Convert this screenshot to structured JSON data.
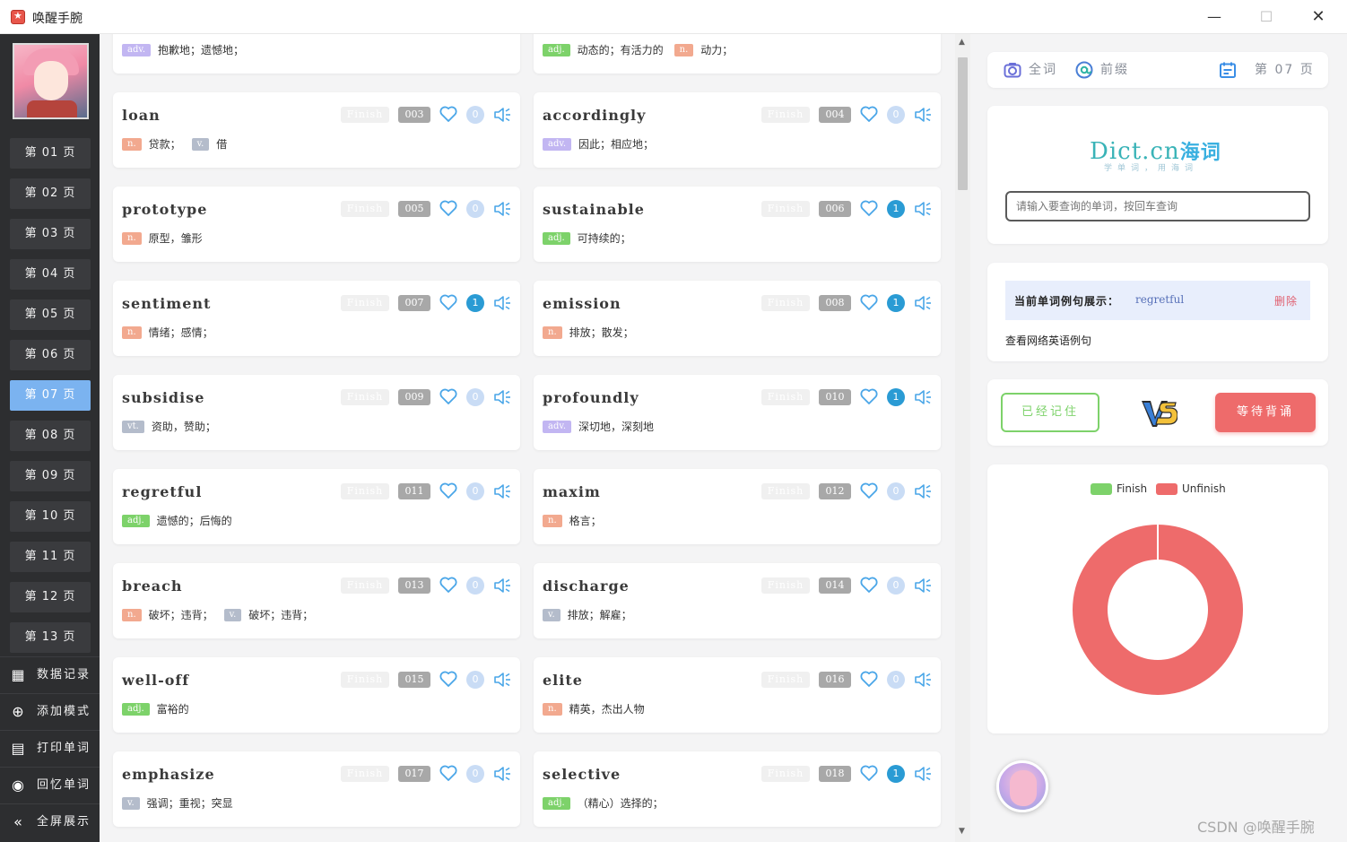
{
  "window": {
    "title": "唤醒手腕"
  },
  "sidebar": {
    "pages": [
      "第 01 页",
      "第 02 页",
      "第 03 页",
      "第 04 页",
      "第 05 页",
      "第 06 页",
      "第 07 页",
      "第 08 页",
      "第 09 页",
      "第 10 页",
      "第 11 页",
      "第 12 页",
      "第 13 页"
    ],
    "active_page_index": 6,
    "menu": [
      {
        "label": "数据记录",
        "icon": "grid-icon"
      },
      {
        "label": "添加模式",
        "icon": "plus-circle-icon"
      },
      {
        "label": "打印单词",
        "icon": "print-icon"
      },
      {
        "label": "回忆单词",
        "icon": "eye-icon"
      },
      {
        "label": "全屏展示",
        "icon": "double-chevron-left-icon"
      }
    ]
  },
  "cards_top": [
    {
      "defs": [
        {
          "pos": "adv.",
          "text": "抱歉地；遗憾地；"
        }
      ]
    },
    {
      "defs": [
        {
          "pos": "adj.",
          "text": "动态的；有活力的"
        },
        {
          "pos": "n.",
          "text": "动力；"
        }
      ]
    }
  ],
  "words": [
    {
      "word": "loan",
      "finish": "Finish",
      "num": "003",
      "count": "0",
      "defs": [
        {
          "pos": "n.",
          "text": "贷款；"
        },
        {
          "pos": "v.",
          "text": "借"
        }
      ]
    },
    {
      "word": "accordingly",
      "finish": "Finish",
      "num": "004",
      "count": "0",
      "defs": [
        {
          "pos": "adv.",
          "text": "因此；相应地；"
        }
      ]
    },
    {
      "word": "prototype",
      "finish": "Finish",
      "num": "005",
      "count": "0",
      "defs": [
        {
          "pos": "n.",
          "text": "原型，雏形"
        }
      ]
    },
    {
      "word": "sustainable",
      "finish": "Finish",
      "num": "006",
      "count": "1",
      "defs": [
        {
          "pos": "adj.",
          "text": "可持续的；"
        }
      ]
    },
    {
      "word": "sentiment",
      "finish": "Finish",
      "num": "007",
      "count": "1",
      "defs": [
        {
          "pos": "n.",
          "text": "情绪；感情；"
        }
      ]
    },
    {
      "word": "emission",
      "finish": "Finish",
      "num": "008",
      "count": "1",
      "defs": [
        {
          "pos": "n.",
          "text": "排放；散发；"
        }
      ]
    },
    {
      "word": "subsidise",
      "finish": "Finish",
      "num": "009",
      "count": "0",
      "defs": [
        {
          "pos": "vt.",
          "text": "资助，赞助；"
        }
      ]
    },
    {
      "word": "profoundly",
      "finish": "Finish",
      "num": "010",
      "count": "1",
      "defs": [
        {
          "pos": "adv.",
          "text": "深切地，深刻地"
        }
      ]
    },
    {
      "word": "regretful",
      "finish": "Finish",
      "num": "011",
      "count": "0",
      "defs": [
        {
          "pos": "adj.",
          "text": "遗憾的；后悔的"
        }
      ]
    },
    {
      "word": "maxim",
      "finish": "Finish",
      "num": "012",
      "count": "0",
      "defs": [
        {
          "pos": "n.",
          "text": "格言；"
        }
      ]
    },
    {
      "word": "breach",
      "finish": "Finish",
      "num": "013",
      "count": "0",
      "defs": [
        {
          "pos": "n.",
          "text": "破坏；违背；"
        },
        {
          "pos": "v.",
          "text": "破坏；违背；"
        }
      ]
    },
    {
      "word": "discharge",
      "finish": "Finish",
      "num": "014",
      "count": "0",
      "defs": [
        {
          "pos": "v.",
          "text": "排放；解雇；"
        }
      ]
    },
    {
      "word": "well-off",
      "finish": "Finish",
      "num": "015",
      "count": "0",
      "defs": [
        {
          "pos": "adj.",
          "text": "富裕的"
        }
      ]
    },
    {
      "word": "elite",
      "finish": "Finish",
      "num": "016",
      "count": "0",
      "defs": [
        {
          "pos": "n.",
          "text": "精英，杰出人物"
        }
      ]
    },
    {
      "word": "emphasize",
      "finish": "Finish",
      "num": "017",
      "count": "0",
      "defs": [
        {
          "pos": "v.",
          "text": "强调；重视；突显"
        }
      ]
    },
    {
      "word": "selective",
      "finish": "Finish",
      "num": "018",
      "count": "1",
      "defs": [
        {
          "pos": "adj.",
          "text": "（精心）选择的；"
        }
      ]
    }
  ],
  "right": {
    "nav": {
      "all_words": "全词",
      "prefix": "前缀",
      "page": "第 07 页"
    },
    "dict": {
      "logo": "Dict.cn",
      "logo_cn": "海词",
      "slogan": "学单词，用海词",
      "placeholder": "请输入要查询的单词，按回车查询"
    },
    "example": {
      "label": "当前单词例句展示：",
      "word": "regretful",
      "delete": "删除",
      "link": "查看网络英语例句"
    },
    "actions": {
      "remembered": "已经记住",
      "vs": "VS",
      "waiting": "等待背诵"
    },
    "chart_labels": {
      "finish": "Finish",
      "unfinish": "Unfinish"
    }
  },
  "chart_data": {
    "type": "pie",
    "donut": true,
    "series": [
      {
        "name": "Finish",
        "value": 0,
        "color": "#7dd26a"
      },
      {
        "name": "Unfinish",
        "value": 1,
        "color": "#ee6b6b"
      }
    ],
    "legend": "top-center"
  },
  "watermark": "CSDN @唤醒手腕",
  "colors": {
    "sidebar_bg": "#2d2e30",
    "active_page": "#7bb3f0",
    "finish_green": "#7dd26a",
    "unfinish_red": "#ee6b6b"
  }
}
